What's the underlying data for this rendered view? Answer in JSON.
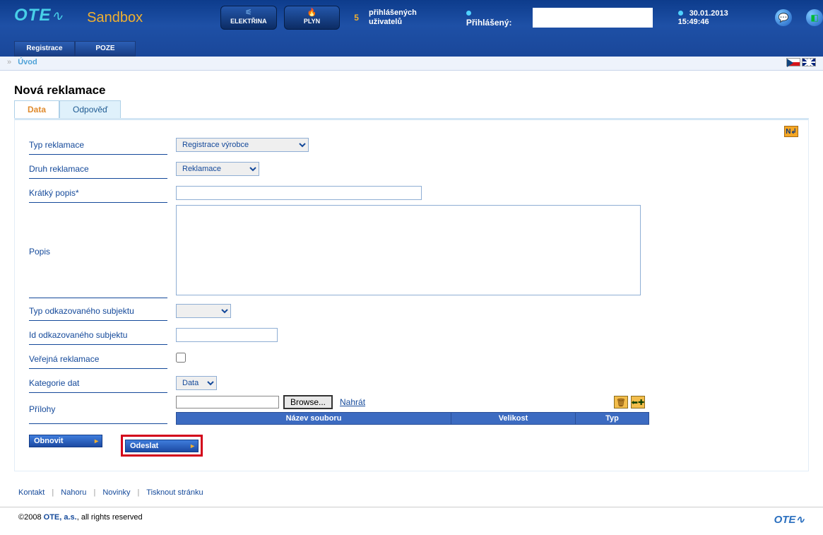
{
  "header": {
    "brand": "OTE",
    "sandbox": "Sandbox",
    "elektrina": "ELEKTŘINA",
    "plyn": "PLYN",
    "users_count": "5",
    "users_label_line1": "přihlášených",
    "users_label_line2": "uživatelů",
    "logged_in_label": "Přihlášený:",
    "timestamp": "30.01.2013 15:49:46",
    "nav": {
      "registrace": "Registrace",
      "poze": "POZE"
    }
  },
  "breadcrumb": {
    "home": "Úvod"
  },
  "page": {
    "title": "Nová reklamace",
    "tabs": {
      "data": "Data",
      "odpoved": "Odpověď"
    }
  },
  "form": {
    "typ_reklamace": {
      "label": "Typ reklamace",
      "value": "Registrace výrobce"
    },
    "druh_reklamace": {
      "label": "Druh reklamace",
      "value": "Reklamace"
    },
    "kratky_popis": {
      "label": "Krátký popis*",
      "value": ""
    },
    "popis": {
      "label": "Popis",
      "value": ""
    },
    "typ_odkaz_sub": {
      "label": "Typ odkazovaného subjektu",
      "value": ""
    },
    "id_odkaz_sub": {
      "label": "Id odkazovaného subjektu",
      "value": ""
    },
    "verejna": {
      "label": "Veřejná reklamace"
    },
    "kategorie_dat": {
      "label": "Kategorie dat",
      "value": "Data"
    },
    "prilohy": {
      "label": "Přílohy",
      "browse": "Browse...",
      "upload": "Nahrát",
      "cols": {
        "name": "Název souboru",
        "size": "Velikost",
        "type": "Typ"
      }
    }
  },
  "actions": {
    "obnovit": "Obnovit",
    "odeslat": "Odeslat"
  },
  "footer": {
    "links": {
      "kontakt": "Kontakt",
      "nahoru": "Nahoru",
      "novinky": "Novinky",
      "tisk": "Tisknout stránku"
    },
    "copyright_year": "©2008 ",
    "company": "OTE, a.s.",
    "copyright_rest": ", all rights reserved",
    "logo": "OTE"
  }
}
